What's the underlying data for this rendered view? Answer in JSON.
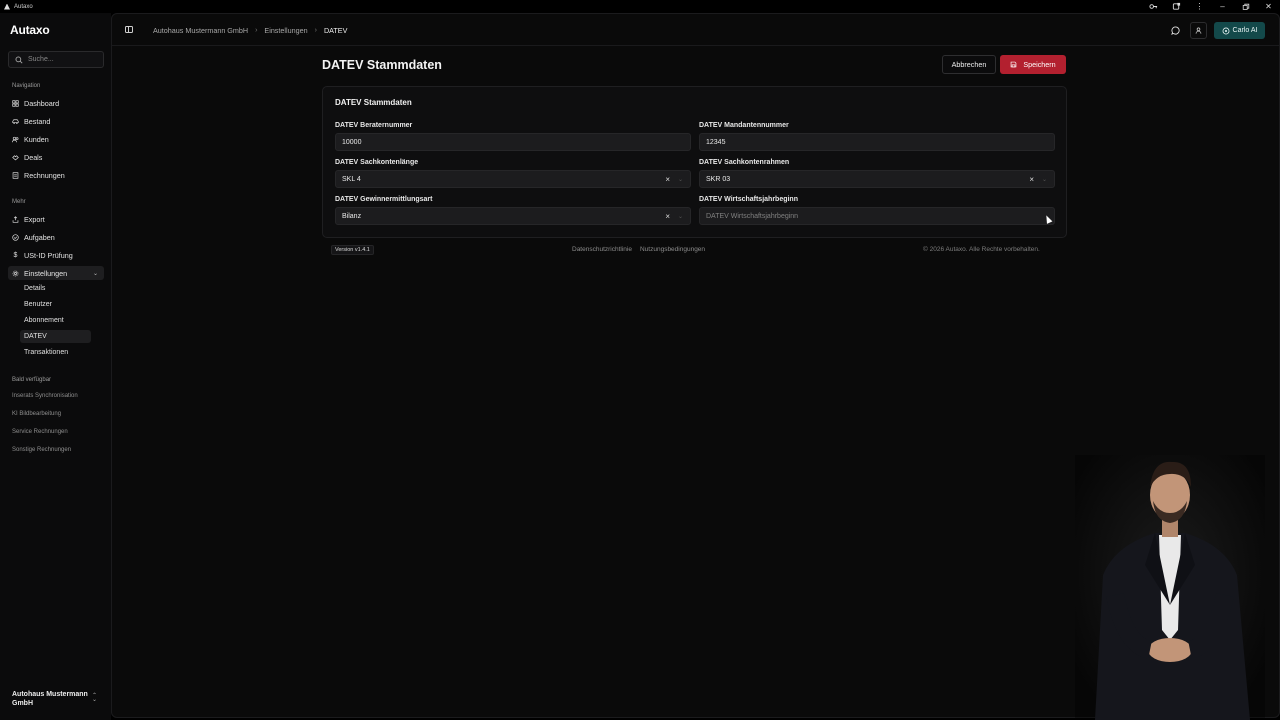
{
  "os": {
    "app_name": "Autaxo"
  },
  "sidebar": {
    "brand": "Autaxo",
    "search_placeholder": "Suche...",
    "nav_label": "Navigation",
    "nav_items": [
      {
        "label": "Dashboard",
        "icon": "dashboard-icon"
      },
      {
        "label": "Bestand",
        "icon": "car-icon"
      },
      {
        "label": "Kunden",
        "icon": "users-icon"
      },
      {
        "label": "Deals",
        "icon": "handshake-icon"
      },
      {
        "label": "Rechnungen",
        "icon": "invoice-icon"
      }
    ],
    "more_label": "Mehr",
    "more_items": [
      {
        "label": "Export",
        "icon": "export-icon"
      },
      {
        "label": "Aufgaben",
        "icon": "check-circle-icon"
      },
      {
        "label": "USt-ID Prüfung",
        "icon": "dollar-icon"
      },
      {
        "label": "Einstellungen",
        "icon": "gear-icon"
      }
    ],
    "settings_sub": [
      "Details",
      "Benutzer",
      "Abonnement",
      "DATEV",
      "Transaktionen"
    ],
    "soon_label": "Bald verfügbar",
    "soon_items": [
      "Inserats Synchronisation",
      "KI Bildbearbeitung",
      "Service Rechnungen",
      "Sonstige Rechnungen"
    ],
    "company_name": "Autohaus Mustermann GmbH"
  },
  "topbar": {
    "breadcrumb": [
      "Autohaus Mustermann GmbH",
      "Einstellungen",
      "DATEV"
    ],
    "assistant_label": "Carlo AI"
  },
  "page": {
    "title": "DATEV Stammdaten",
    "cancel_label": "Abbrechen",
    "save_label": "Speichern",
    "accent_color": "#b3202f"
  },
  "form": {
    "card_title": "DATEV Stammdaten",
    "berater_label": "DATEV Beraternummer",
    "berater_value": "10000",
    "mandant_label": "DATEV Mandantennummer",
    "mandant_value": "12345",
    "skl_label": "DATEV Sachkontenlänge",
    "skl_value": "SKL 4",
    "skr_label": "DATEV Sachkontenrahmen",
    "skr_value": "SKR 03",
    "gewinn_label": "DATEV Gewinnermittlungsart",
    "gewinn_value": "Bilanz",
    "wj_label": "DATEV Wirtschaftsjahrbeginn",
    "wj_placeholder": "DATEV Wirtschaftsjahrbeginn"
  },
  "footer": {
    "version": "Version v1.4.1",
    "privacy": "Datenschutzrichtlinie",
    "terms": "Nutzungsbedingungen",
    "copyright": "© 2026 Autaxo. Alle Rechte vorbehalten."
  }
}
